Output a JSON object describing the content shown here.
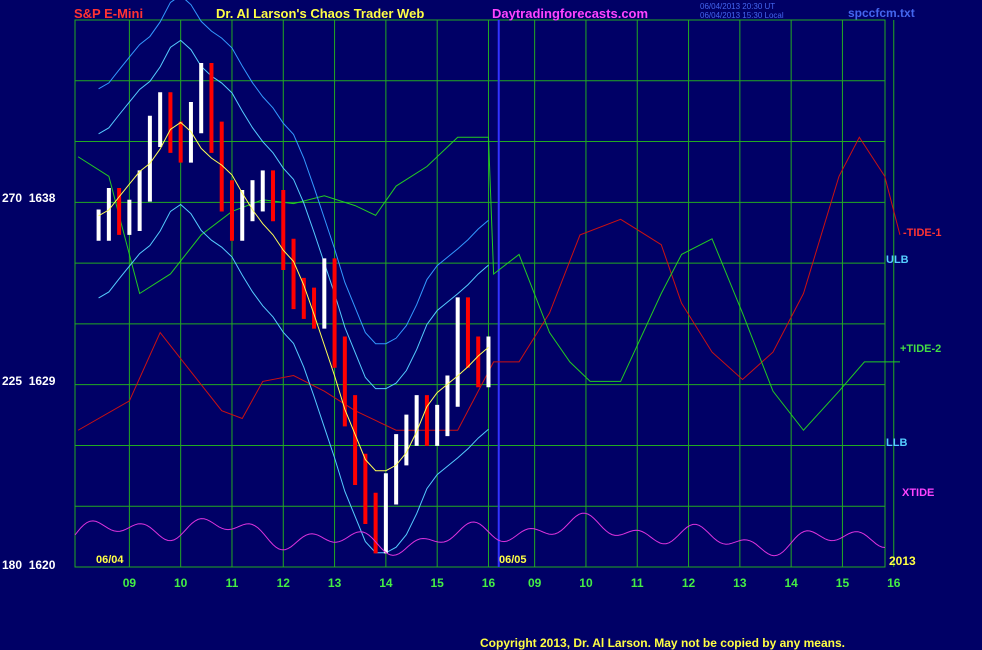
{
  "header": {
    "instrument": "S&P E-Mini",
    "site_title": "Dr. Al Larson's Chaos Trader Web",
    "site_url": "Daytradingforecasts.com",
    "timestamp_line1": "06/04/2013 20:30 UT",
    "timestamp_line2": "06/04/2013 15:30 Local",
    "data_file": "spccfcm.txt"
  },
  "footer": {
    "copyright": "Copyright 2013, Dr. Al Larson. May not be copied by any means."
  },
  "colors": {
    "background": "#000066",
    "grid": "#22aa22",
    "tide1": "#cc1111",
    "tide2": "#22cc22",
    "ulb": "#55ccff",
    "llb": "#55ccff",
    "xtide": "#dd33dd",
    "price_up": "#ffffff",
    "price_down": "#ff0000",
    "moving_avg": "#ffff55",
    "now_line": "#3333ff"
  },
  "chart_data": {
    "type": "line",
    "title": "S&P E-Mini",
    "y_axis": {
      "ticks": [
        {
          "angle": "270",
          "price": "1638"
        },
        {
          "angle": "225",
          "price": "1629"
        },
        {
          "angle": "180",
          "price": "1620"
        }
      ],
      "ylim": [
        1620,
        1648
      ]
    },
    "x_axis": {
      "hour_labels": [
        "09",
        "10",
        "11",
        "12",
        "13",
        "14",
        "15",
        "16",
        "09",
        "10",
        "11",
        "12",
        "13",
        "14",
        "15",
        "16"
      ],
      "date_labels": [
        "06/04",
        "06/05"
      ],
      "year_label": "2013"
    },
    "grid": true,
    "series_labels": {
      "tide1": "-TIDE-1",
      "ulb": "ULB",
      "tide2": "+TIDE-2",
      "llb": "LLB",
      "xtide": "XTIDE"
    },
    "price_bars": {
      "hours": [
        8.4,
        8.6,
        8.8,
        9.0,
        9.2,
        9.4,
        9.6,
        9.8,
        10.0,
        10.2,
        10.4,
        10.6,
        10.8,
        11.0,
        11.2,
        11.4,
        11.6,
        11.8,
        12.0,
        12.2,
        12.4,
        12.6,
        12.8,
        13.0,
        13.2,
        13.4,
        13.6,
        13.8,
        14.0,
        14.2,
        14.4,
        14.6,
        14.8,
        15.0,
        15.2,
        15.4,
        15.6,
        15.8,
        16.0
      ],
      "close": [
        1637.5,
        1638.6,
        1637.8,
        1638.0,
        1639.5,
        1642.3,
        1643.5,
        1642.0,
        1641.5,
        1643.0,
        1645.0,
        1642.0,
        1639.0,
        1637.5,
        1638.5,
        1639.0,
        1639.5,
        1638.5,
        1636.0,
        1634.0,
        1633.5,
        1633.0,
        1635.0,
        1631.0,
        1628.0,
        1625.0,
        1623.0,
        1621.5,
        1624.0,
        1626.0,
        1627.0,
        1628.0,
        1627.0,
        1627.5,
        1629.0,
        1633.0,
        1631.0,
        1630.0,
        1631.0
      ]
    },
    "tide1_hours": [
      8.0,
      9.0,
      9.6,
      10.2,
      10.8,
      11.2,
      11.6,
      12.2,
      12.8,
      13.4,
      13.8,
      14.2,
      14.8,
      15.4,
      16.1,
      16.6,
      17.2,
      17.8,
      18.6,
      19.4,
      19.8,
      20.4,
      21.0,
      21.6,
      22.2,
      22.9,
      23.3,
      23.8,
      24.1
    ],
    "tide1": [
      1627.0,
      1628.5,
      1632.0,
      1630.0,
      1628.0,
      1627.6,
      1629.5,
      1629.8,
      1629.0,
      1628.0,
      1627.5,
      1627.0,
      1627.0,
      1627.0,
      1630.5,
      1630.5,
      1633.0,
      1637.0,
      1637.8,
      1636.5,
      1633.5,
      1631.0,
      1629.6,
      1631.0,
      1634.0,
      1640.0,
      1642.0,
      1640.0,
      1637.0
    ],
    "tide2_hours": [
      8.0,
      8.6,
      9.2,
      9.8,
      10.4,
      11.0,
      11.6,
      12.2,
      12.8,
      13.4,
      13.8,
      14.2,
      14.8,
      15.4,
      16.0,
      16.1,
      16.6,
      17.2,
      17.6,
      18.0,
      18.6,
      19.4,
      19.8,
      20.4,
      21.0,
      21.6,
      22.2,
      22.9,
      23.4,
      24.1
    ],
    "tide2": [
      1641.0,
      1640.0,
      1634.0,
      1635.0,
      1637.0,
      1638.2,
      1638.8,
      1638.6,
      1639.0,
      1638.5,
      1638.0,
      1639.5,
      1640.5,
      1642.0,
      1642.0,
      1635.0,
      1636.0,
      1632.0,
      1630.5,
      1629.5,
      1629.5,
      1634.0,
      1636.0,
      1636.8,
      1633.0,
      1629.0,
      1627.0,
      1629.0,
      1630.5,
      1630.5
    ]
  }
}
